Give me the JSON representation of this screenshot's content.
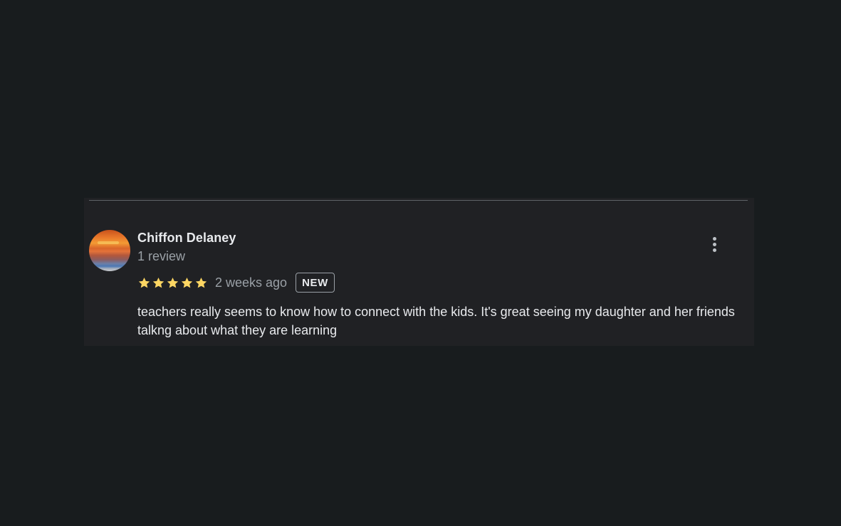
{
  "review": {
    "reviewer_name": "Chiffon Delaney",
    "review_count": "1 review",
    "rating": 5,
    "rating_max": 5,
    "time_ago": "2 weeks ago",
    "badge": "NEW",
    "text": "teachers really seems to know how to connect with the kids. It's great seeing my daughter and her friends talkng about what they are learning",
    "avatar_icon": "sunset-photo",
    "menu_icon": "more-vert-icon",
    "star_icon": "star-icon"
  },
  "colors": {
    "page_background": "#181c1e",
    "card_background": "#202124",
    "star": "#fdd663",
    "primary_text": "#e8eaed",
    "secondary_text": "#9aa0a6"
  }
}
